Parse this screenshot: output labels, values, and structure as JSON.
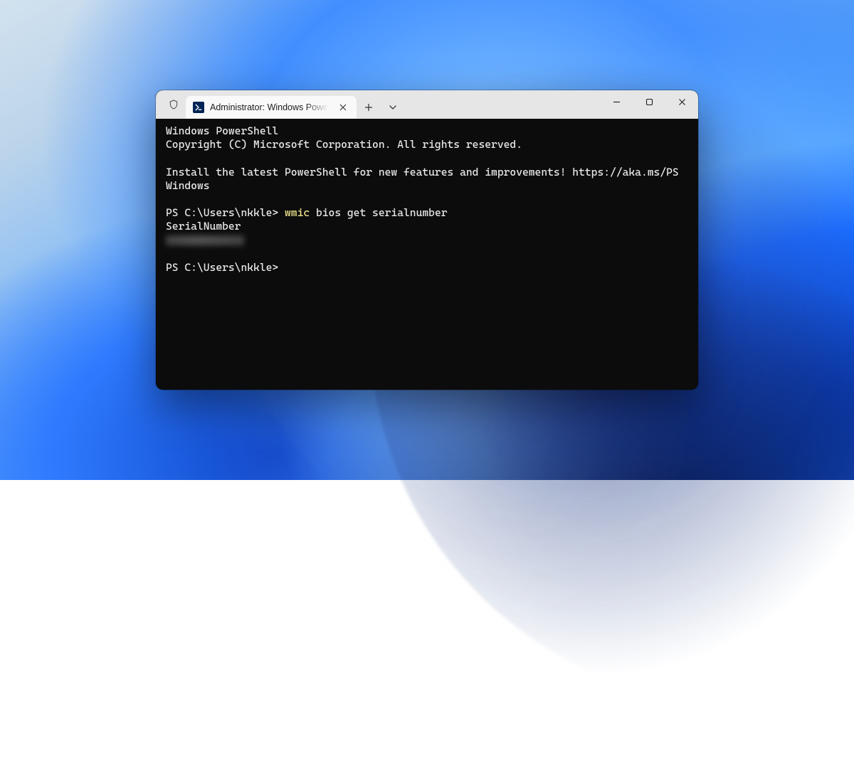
{
  "tab": {
    "title": "Administrator: Windows PowerShell"
  },
  "terminal": {
    "banner_line1": "Windows PowerShell",
    "banner_line2": "Copyright (C) Microsoft Corporation. All rights reserved.",
    "tip_line1": "Install the latest PowerShell for new features and improvements! https://aka.ms/PS",
    "tip_line2": "Windows",
    "prompt1_prefix": "PS C:\\Users\\nkkle> ",
    "prompt1_cmd_highlight": "wmic",
    "prompt1_cmd_rest": " bios get serialnumber",
    "output_header": "SerialNumber",
    "prompt2": "PS C:\\Users\\nkkle>"
  }
}
